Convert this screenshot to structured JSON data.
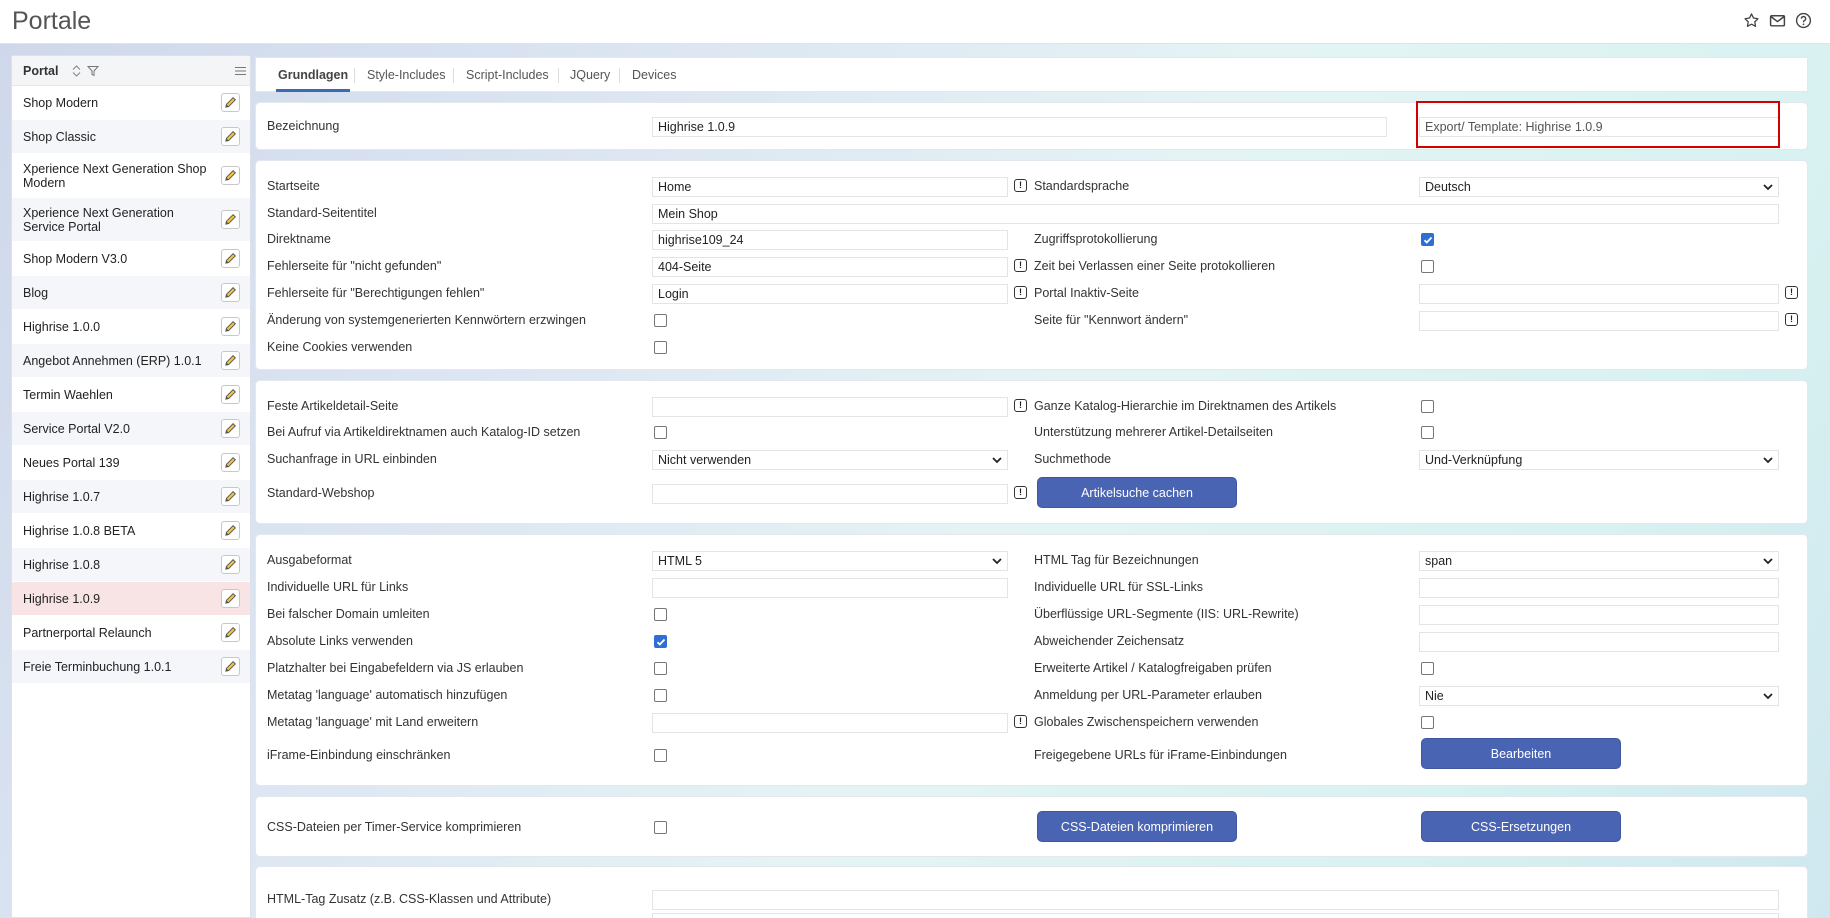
{
  "app": {
    "title": "Portale"
  },
  "icons": {
    "star": "star-icon",
    "mail": "mail-icon",
    "help": "help-icon",
    "sort": "sort-icon",
    "filter": "filter-icon",
    "menu": "menu-icon",
    "edit": "pencil-icon",
    "info": "info-icon",
    "check": "check-icon",
    "chevron": "chevron-down-icon"
  },
  "colors": {
    "accent": "#4a64b4",
    "active_tab": "#3a6ab0",
    "selected_row": "#f8e4e4",
    "highlight_box": "#d40000",
    "checkbox_on": "#2f6fd4"
  },
  "sidebar": {
    "title": "Portal",
    "items": [
      {
        "label": "Shop Modern"
      },
      {
        "label": "Shop Classic"
      },
      {
        "label": "Xperience Next Generation Shop Modern"
      },
      {
        "label": "Xperience Next Generation Service Portal"
      },
      {
        "label": "Shop Modern V3.0"
      },
      {
        "label": "Blog"
      },
      {
        "label": "Highrise 1.0.0"
      },
      {
        "label": "Angebot Annehmen (ERP) 1.0.1"
      },
      {
        "label": "Termin Waehlen"
      },
      {
        "label": "Service Portal V2.0"
      },
      {
        "label": "Neues Portal 139"
      },
      {
        "label": "Highrise 1.0.7"
      },
      {
        "label": "Highrise 1.0.8 BETA"
      },
      {
        "label": "Highrise 1.0.8"
      },
      {
        "label": "Highrise 1.0.9",
        "selected": true
      },
      {
        "label": "Partnerportal Relaunch"
      },
      {
        "label": "Freie Terminbuchung 1.0.1"
      }
    ]
  },
  "tabs": [
    "Grundlagen",
    "Style-Includes",
    "Script-Includes",
    "JQuery",
    "Devices"
  ],
  "section1": {
    "bezeichnung_label": "Bezeichnung",
    "bezeichnung_value": "Highrise 1.0.9",
    "export_template": "Export/ Template: Highrise 1.0.9"
  },
  "section2": {
    "startseite_label": "Startseite",
    "startseite_value": "Home",
    "standardsprache_label": "Standardsprache",
    "standardsprache_value": "Deutsch",
    "seitentitel_label": "Standard-Seitentitel",
    "seitentitel_value": "Mein Shop",
    "direktname_label": "Direktname",
    "direktname_value": "highrise109_24",
    "zugriff_label": "Zugriffsprotokollierung",
    "zugriff_checked": true,
    "nichtgefunden_label": "Fehlerseite für \"nicht gefunden\"",
    "nichtgefunden_value": "404-Seite",
    "zeitverlassen_label": "Zeit bei Verlassen einer Seite protokollieren",
    "zeitverlassen_checked": false,
    "berechtigungen_label": "Fehlerseite für \"Berechtigungen fehlen\"",
    "berechtigungen_value": "Login",
    "inaktiv_label": "Portal Inaktiv-Seite",
    "inaktiv_value": "",
    "kennwort_erzwingen_label": "Änderung von systemgenerierten Kennwörtern erzwingen",
    "kennwort_erzwingen_checked": false,
    "kennwort_aendern_label": "Seite für \"Kennwort ändern\"",
    "kennwort_aendern_value": "",
    "cookies_label": "Keine Cookies verwenden",
    "cookies_checked": false
  },
  "section3": {
    "artikeldetail_label": "Feste Artikeldetail-Seite",
    "artikeldetail_value": "",
    "katalog_hierarchie_label": "Ganze Katalog-Hierarchie im Direktnamen des Artikels",
    "katalog_hierarchie_checked": false,
    "katalog_id_label": "Bei Aufruf via Artikeldirektnamen auch Katalog-ID setzen",
    "katalog_id_checked": false,
    "mehrere_detail_label": "Unterstützung mehrerer Artikel-Detailseiten",
    "mehrere_detail_checked": false,
    "suchanfrage_label": "Suchanfrage in URL einbinden",
    "suchanfrage_value": "Nicht verwenden",
    "suchmethode_label": "Suchmethode",
    "suchmethode_value": "Und-Verknüpfung",
    "webshop_label": "Standard-Webshop",
    "webshop_value": "",
    "cache_button": "Artikelsuche cachen"
  },
  "section4": {
    "ausgabeformat_label": "Ausgabeformat",
    "ausgabeformat_value": "HTML 5",
    "htmltag_label": "HTML Tag für Bezeichnungen",
    "htmltag_value": "span",
    "url_links_label": "Individuelle URL für Links",
    "url_links_value": "",
    "ssl_links_label": "Individuelle URL für SSL-Links",
    "ssl_links_value": "",
    "falsche_domain_label": "Bei falscher Domain umleiten",
    "falsche_domain_checked": false,
    "url_segmente_label": "Überflüssige URL-Segmente (IIS: URL-Rewrite)",
    "url_segmente_value": "",
    "absolute_links_label": "Absolute Links verwenden",
    "absolute_links_checked": true,
    "zeichensatz_label": "Abweichender Zeichensatz",
    "zeichensatz_value": "",
    "platzhalter_label": "Platzhalter bei Eingabefeldern via JS erlauben",
    "platzhalter_checked": false,
    "katalogfreigaben_label": "Erweiterte Artikel / Katalogfreigaben prüfen",
    "katalogfreigaben_checked": false,
    "metatag_lang_label": "Metatag 'language' automatisch hinzufügen",
    "metatag_lang_checked": false,
    "anmeldung_label": "Anmeldung per URL-Parameter erlauben",
    "anmeldung_value": "Nie",
    "metatag_land_label": "Metatag 'language' mit Land erweitern",
    "metatag_land_value": "",
    "zwischenspeichern_label": "Globales Zwischenspeichern verwenden",
    "zwischenspeichern_checked": false,
    "iframe_label": "iFrame-Einbindung einschränken",
    "iframe_checked": false,
    "iframe_urls_label": "Freigegebene URLs für iFrame-Einbindungen",
    "bearbeiten_button": "Bearbeiten"
  },
  "section5": {
    "css_timer_label": "CSS-Dateien per Timer-Service komprimieren",
    "css_timer_checked": false,
    "css_compress_button": "CSS-Dateien komprimieren",
    "css_replace_button": "CSS-Ersetzungen"
  },
  "section6": {
    "html_tag_zusatz_label": "HTML-Tag Zusatz (z.B. CSS-Klassen und Attribute)",
    "html_tag_zusatz_value": ""
  }
}
